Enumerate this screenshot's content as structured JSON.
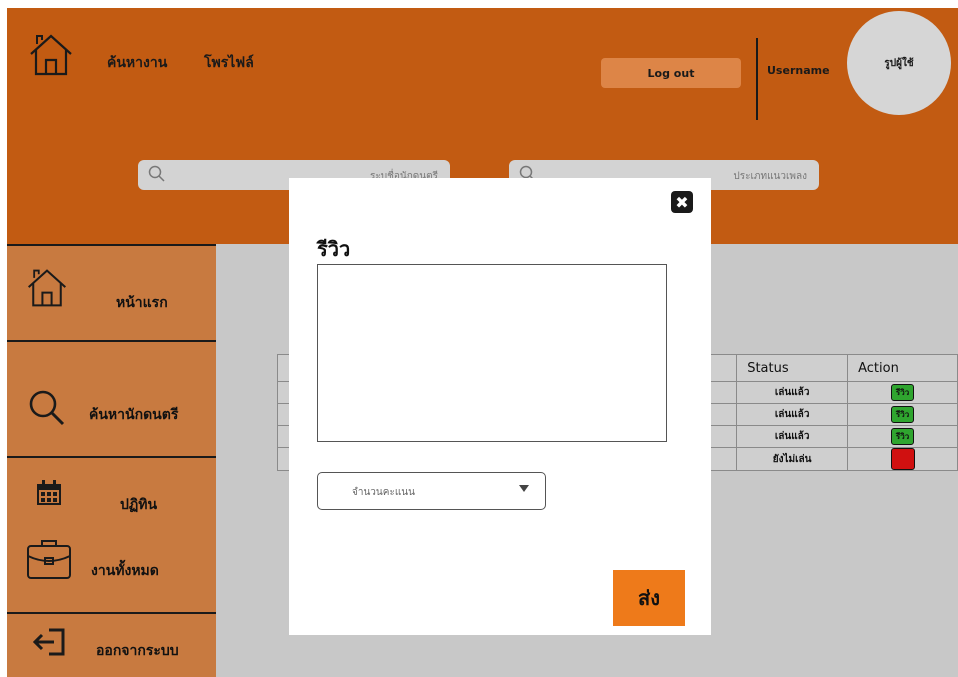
{
  "header": {
    "nav": {
      "search_jobs": "ค้นหางาน",
      "profile": "โพรไฟล์"
    },
    "logout_label": "Log out",
    "username": "Username",
    "avatar_label": "รูปผู้ใช้",
    "search_left_placeholder": "ระบุชื่อนักดนตรี",
    "search_right_placeholder": "ประเภทแนวเพลง"
  },
  "sidebar": {
    "items": [
      {
        "label": "หน้าแรก",
        "icon": "home-icon"
      },
      {
        "label": "ค้นหานักดนตรี",
        "icon": "search-icon"
      },
      {
        "label": "ปฏิทิน",
        "icon": "calendar-icon"
      },
      {
        "label": "งานทั้งหมด",
        "icon": "briefcase-icon"
      },
      {
        "label": "ออกจากระบบ",
        "icon": "logout-icon"
      }
    ]
  },
  "table": {
    "headers": {
      "status": "Status",
      "action": "Action"
    },
    "rows": [
      {
        "status": "เล่นแล้ว",
        "action": "รีวิว"
      },
      {
        "status": "เล่นแล้ว",
        "action": "รีวิว"
      },
      {
        "status": "เล่นแล้ว",
        "action": "รีวิว"
      },
      {
        "status": "ยังไม่เล่น",
        "action": ""
      }
    ]
  },
  "modal": {
    "title": "รีวิว",
    "close_icon": "close-icon",
    "score_placeholder": "จำนวนคะแนน",
    "submit_label": "ส่ง"
  },
  "colors": {
    "header_bg": "#c25b12",
    "sidebar_bg": "#c87a40",
    "logout_bg": "#dd8547",
    "submit_bg": "#ee7a1a",
    "review_badge": "#2fa52f",
    "not_played_badge": "#d01010"
  }
}
